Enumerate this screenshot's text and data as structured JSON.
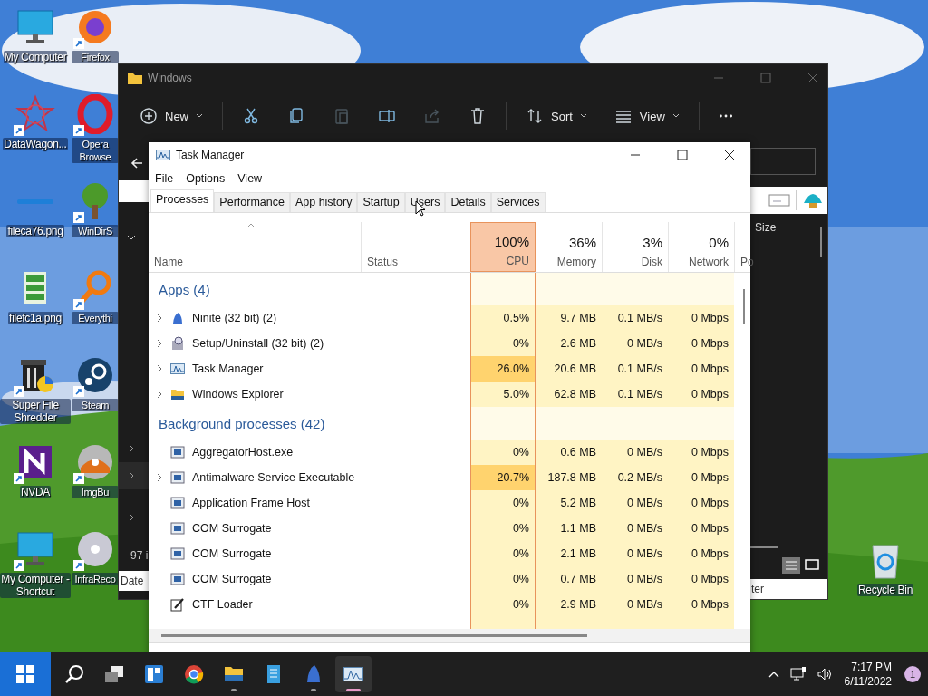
{
  "desktop": {
    "left_icons": [
      {
        "label": "My Computer",
        "kind": "monitor",
        "shortcut": false
      },
      {
        "label": "DataWagon...",
        "kind": "star",
        "shortcut": true
      },
      {
        "label": "fileca76.png",
        "kind": "bar",
        "shortcut": false
      },
      {
        "label": "filefc1a.png",
        "kind": "list",
        "shortcut": false
      },
      {
        "label": "Super File Shredder",
        "kind": "shredder",
        "shortcut": true
      },
      {
        "label": "NVDA",
        "kind": "nvda",
        "shortcut": true
      },
      {
        "label": "My Computer - Shortcut",
        "kind": "monitor",
        "shortcut": true
      }
    ],
    "second_icons": [
      {
        "label": "Firefox",
        "kind": "firefox",
        "shortcut": true
      },
      {
        "label": "Opera Browse",
        "kind": "opera",
        "shortcut": true
      },
      {
        "label": "WinDirS",
        "kind": "tree",
        "shortcut": true
      },
      {
        "label": "Everythi",
        "kind": "magnifier",
        "shortcut": true
      },
      {
        "label": "Steam",
        "kind": "steam",
        "shortcut": true
      },
      {
        "label": "ImgBu",
        "kind": "disc",
        "shortcut": true
      },
      {
        "label": "InfraReco",
        "kind": "cd",
        "shortcut": true
      }
    ],
    "right_icons": [
      {
        "label": "Recycle Bin",
        "kind": "recycle",
        "shortcut": false
      }
    ]
  },
  "explorer": {
    "title": "Windows",
    "toolbar": [
      {
        "kind": "new",
        "label": "New",
        "disabled": false
      },
      {
        "kind": "cut",
        "disabled": false
      },
      {
        "kind": "copy",
        "disabled": false
      },
      {
        "kind": "paste",
        "disabled": true
      },
      {
        "kind": "rename",
        "disabled": false
      },
      {
        "kind": "share",
        "disabled": true
      },
      {
        "kind": "delete",
        "disabled": false
      },
      {
        "kind": "sort",
        "label": "Sort",
        "disabled": false
      },
      {
        "kind": "view",
        "label": "View",
        "disabled": false
      },
      {
        "kind": "more",
        "disabled": false
      }
    ],
    "status_text": "97 i",
    "column_header": "Date",
    "size_header": "Size",
    "footer_text": "ter"
  },
  "task_manager": {
    "title": "Task Manager",
    "menu": [
      "File",
      "Options",
      "View"
    ],
    "tabs": [
      {
        "label": "Processes",
        "selected": true
      },
      {
        "label": "Performance",
        "selected": false
      },
      {
        "label": "App history",
        "selected": false
      },
      {
        "label": "Startup",
        "selected": false
      },
      {
        "label": "Users",
        "selected": false
      },
      {
        "label": "Details",
        "selected": false
      },
      {
        "label": "Services",
        "selected": false
      }
    ],
    "columns": [
      {
        "label": "Name",
        "sorted": false
      },
      {
        "label": "Status",
        "sorted": false
      },
      {
        "percent": "100%",
        "label": "CPU",
        "sorted": true
      },
      {
        "percent": "36%",
        "label": "Memory",
        "sorted": false
      },
      {
        "percent": "3%",
        "label": "Disk",
        "sorted": false
      },
      {
        "percent": "0%",
        "label": "Network",
        "sorted": false
      },
      {
        "label": "Po",
        "sorted": false
      }
    ],
    "rows": [
      {
        "kind": "group",
        "title": "Apps (4)"
      },
      {
        "kind": "ninite",
        "name": "Ninite (32 bit) (2)",
        "expandable": true,
        "cpu": "0.5%",
        "memory": "9.7 MB",
        "disk": "0.1 MB/s",
        "network": "0 Mbps",
        "cpu_hot": false
      },
      {
        "kind": "setup",
        "name": "Setup/Uninstall (32 bit) (2)",
        "expandable": true,
        "cpu": "0%",
        "memory": "2.6 MB",
        "disk": "0 MB/s",
        "network": "0 Mbps",
        "cpu_hot": false
      },
      {
        "kind": "taskmgr",
        "name": "Task Manager",
        "expandable": true,
        "cpu": "26.0%",
        "memory": "20.6 MB",
        "disk": "0.1 MB/s",
        "network": "0 Mbps",
        "cpu_hot": true
      },
      {
        "kind": "folder",
        "name": "Windows Explorer",
        "expandable": true,
        "cpu": "5.0%",
        "memory": "62.8 MB",
        "disk": "0.1 MB/s",
        "network": "0 Mbps",
        "cpu_hot": false
      },
      {
        "kind": "group",
        "title": "Background processes (42)"
      },
      {
        "kind": "service",
        "name": "AggregatorHost.exe",
        "expandable": false,
        "cpu": "0%",
        "memory": "0.6 MB",
        "disk": "0 MB/s",
        "network": "0 Mbps",
        "cpu_hot": false
      },
      {
        "kind": "service",
        "name": "Antimalware Service Executable",
        "expandable": true,
        "cpu": "20.7%",
        "memory": "187.8 MB",
        "disk": "0.2 MB/s",
        "network": "0 Mbps",
        "cpu_hot": true
      },
      {
        "kind": "service",
        "name": "Application Frame Host",
        "expandable": false,
        "cpu": "0%",
        "memory": "5.2 MB",
        "disk": "0 MB/s",
        "network": "0 Mbps",
        "cpu_hot": false
      },
      {
        "kind": "service",
        "name": "COM Surrogate",
        "expandable": false,
        "cpu": "0%",
        "memory": "1.1 MB",
        "disk": "0 MB/s",
        "network": "0 Mbps",
        "cpu_hot": false
      },
      {
        "kind": "service",
        "name": "COM Surrogate",
        "expandable": false,
        "cpu": "0%",
        "memory": "2.1 MB",
        "disk": "0 MB/s",
        "network": "0 Mbps",
        "cpu_hot": false
      },
      {
        "kind": "service",
        "name": "COM Surrogate",
        "expandable": false,
        "cpu": "0%",
        "memory": "0.7 MB",
        "disk": "0 MB/s",
        "network": "0 Mbps",
        "cpu_hot": false
      },
      {
        "kind": "pen",
        "name": "CTF Loader",
        "expandable": false,
        "cpu": "0%",
        "memory": "2.9 MB",
        "disk": "0 MB/s",
        "network": "0 Mbps",
        "cpu_hot": false
      }
    ]
  },
  "taskbar": {
    "items": [
      {
        "kind": "start",
        "running": false,
        "active": false
      },
      {
        "kind": "search",
        "running": false,
        "active": false
      },
      {
        "kind": "taskview",
        "running": false,
        "active": false
      },
      {
        "kind": "widgets",
        "running": false,
        "active": false
      },
      {
        "kind": "chrome",
        "running": false,
        "active": false
      },
      {
        "kind": "explorer",
        "running": true,
        "active": false
      },
      {
        "kind": "notepad",
        "running": false,
        "active": false
      },
      {
        "kind": "ninite",
        "running": true,
        "active": false
      },
      {
        "kind": "taskmgr",
        "running": true,
        "active": true
      }
    ],
    "time": "7:17 PM",
    "date": "6/11/2022",
    "notifications": "1"
  }
}
